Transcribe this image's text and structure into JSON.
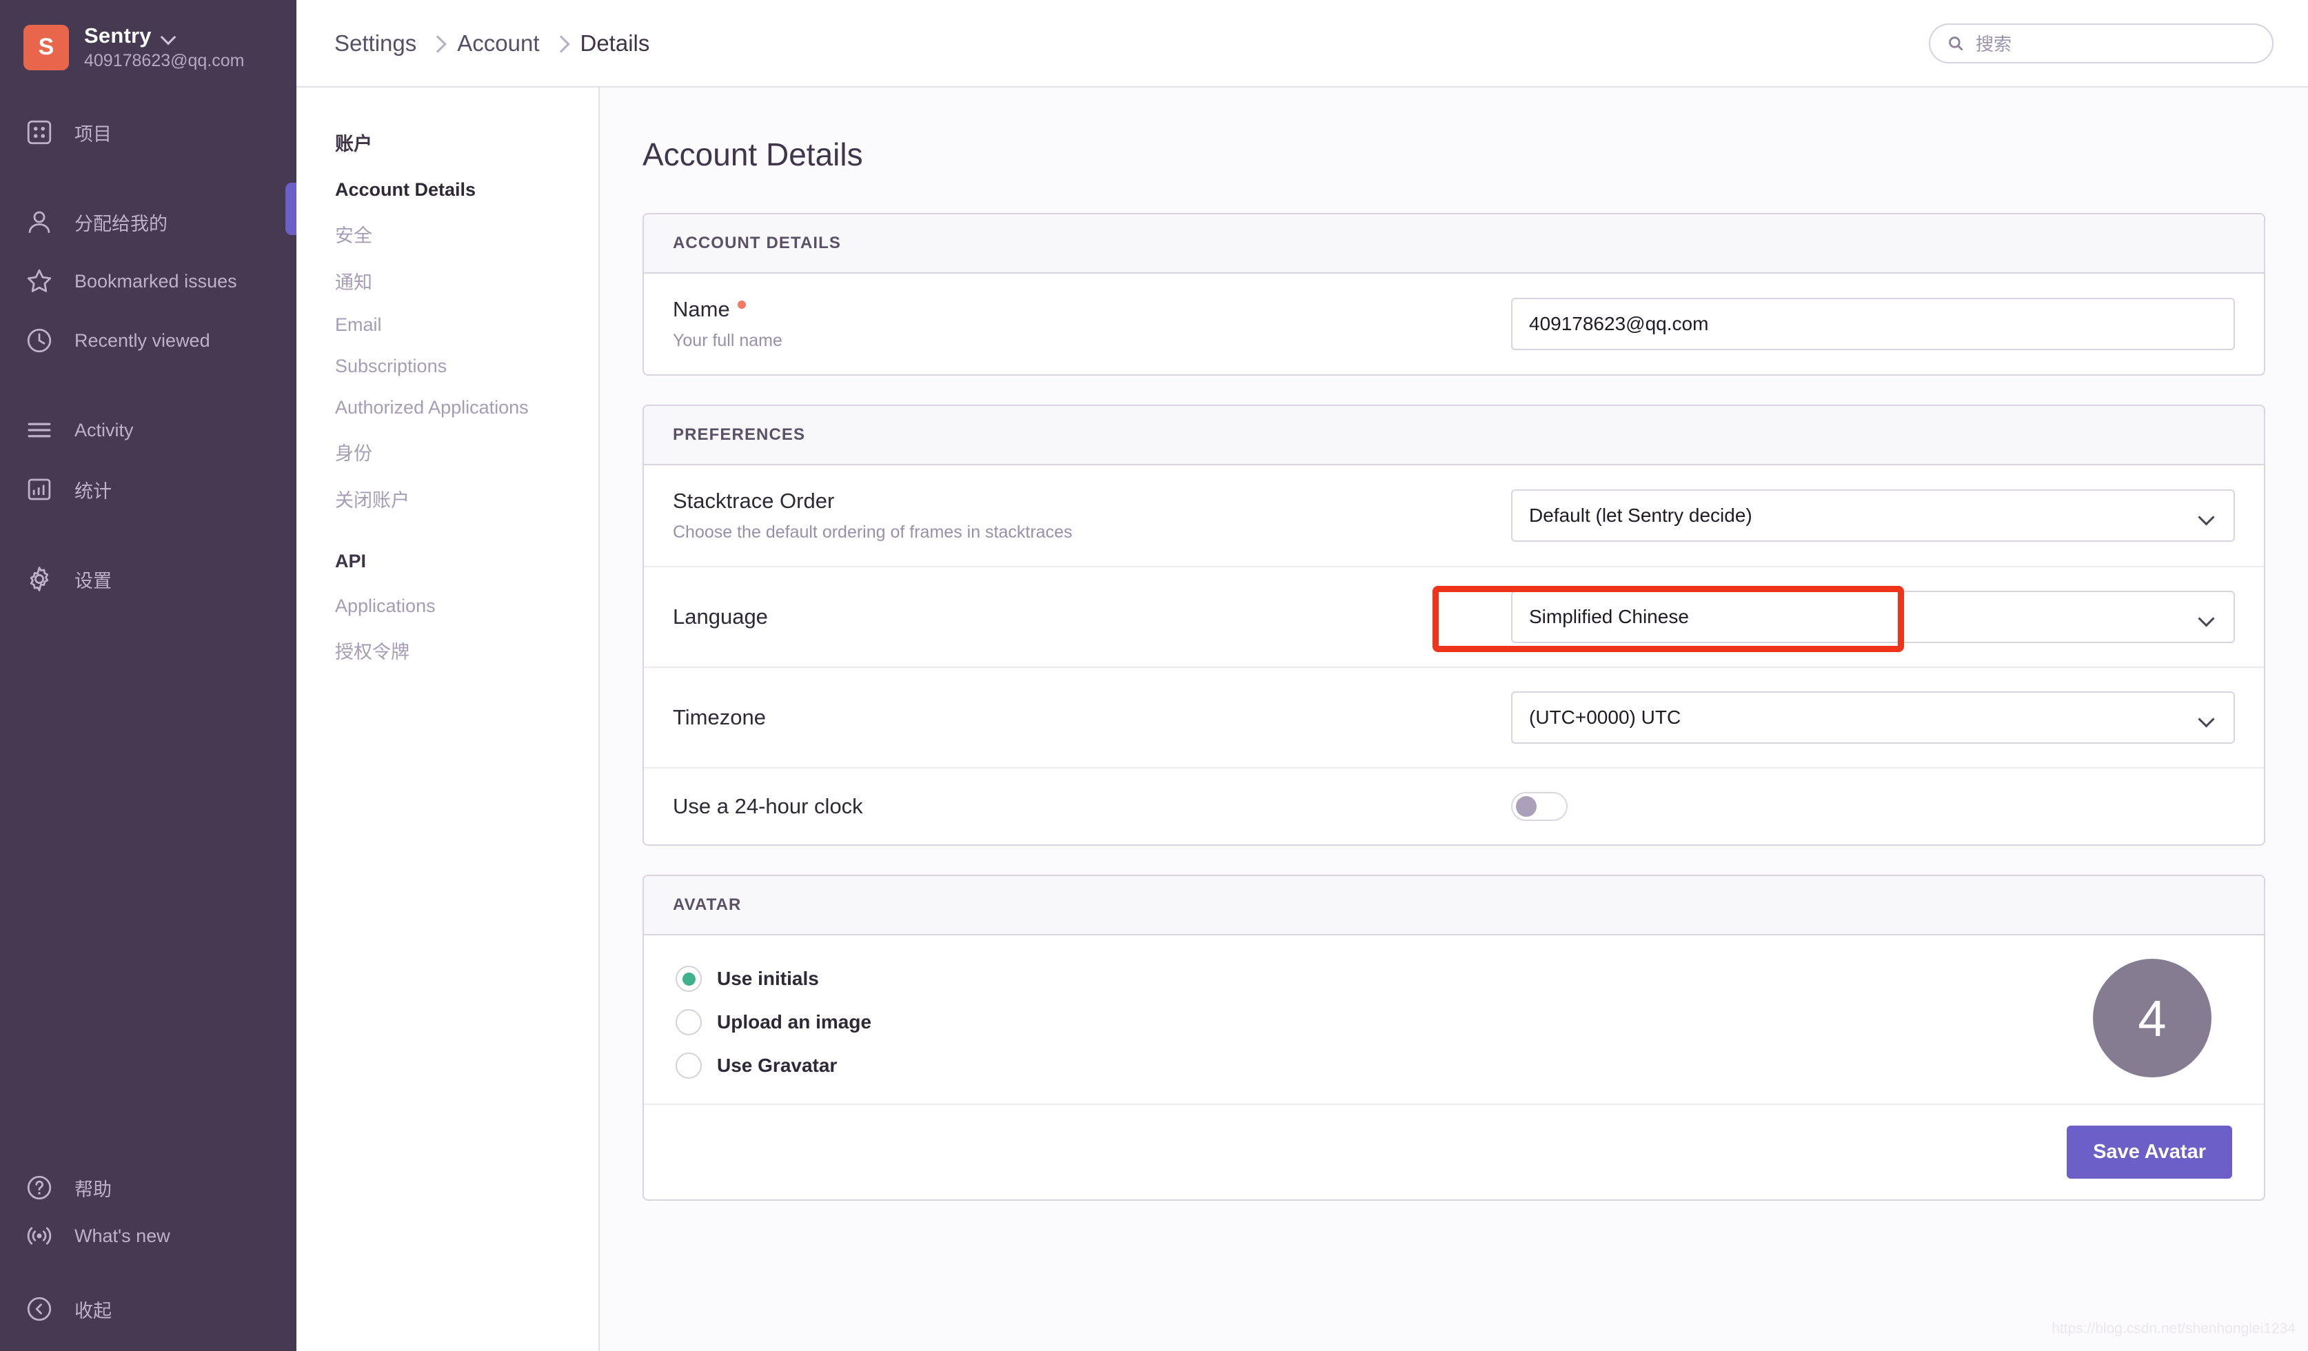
{
  "sidebar": {
    "org": {
      "initial": "S",
      "name": "Sentry",
      "email": "409178623@qq.com"
    },
    "nav_primary": [
      {
        "label": "项目",
        "icon": "projects-icon"
      }
    ],
    "nav_secondary": [
      {
        "label": "分配给我的",
        "icon": "user-icon"
      },
      {
        "label": "Bookmarked issues",
        "icon": "star-icon"
      },
      {
        "label": "Recently viewed",
        "icon": "clock-icon"
      }
    ],
    "nav_tertiary": [
      {
        "label": "Activity",
        "icon": "list-icon"
      },
      {
        "label": "统计",
        "icon": "stats-icon"
      }
    ],
    "nav_quaternary": [
      {
        "label": "设置",
        "icon": "gear-icon"
      }
    ],
    "nav_bottom": [
      {
        "label": "帮助",
        "icon": "help-circle-icon"
      },
      {
        "label": "What's new",
        "icon": "broadcast-icon"
      }
    ],
    "collapse": {
      "label": "收起",
      "icon": "chevron-left-circle-icon"
    }
  },
  "topbar": {
    "breadcrumb": [
      "Settings",
      "Account",
      "Details"
    ],
    "search": {
      "placeholder": "搜索",
      "value": "",
      "icon": "search-icon"
    }
  },
  "settings_nav": {
    "account_heading": "账户",
    "account_items": [
      {
        "label": "Account Details",
        "active": true
      },
      {
        "label": "安全",
        "active": false
      },
      {
        "label": "通知",
        "active": false
      },
      {
        "label": "Email",
        "active": false
      },
      {
        "label": "Subscriptions",
        "active": false
      },
      {
        "label": "Authorized Applications",
        "active": false
      },
      {
        "label": "身份",
        "active": false
      },
      {
        "label": "关闭账户",
        "active": false
      }
    ],
    "api_heading": "API",
    "api_items": [
      {
        "label": "Applications"
      },
      {
        "label": "授权令牌"
      }
    ]
  },
  "content": {
    "page_title": "Account Details",
    "account_details_panel": {
      "header": "ACCOUNT DETAILS",
      "name_label": "Name",
      "name_help": "Your full name",
      "name_value": "409178623@qq.com",
      "required_marker": "required-dot"
    },
    "preferences_panel": {
      "header": "PREFERENCES",
      "stacktrace_label": "Stacktrace Order",
      "stacktrace_help": "Choose the default ordering of frames in stacktraces",
      "stacktrace_value": "Default (let Sentry decide)",
      "language_label": "Language",
      "language_value": "Simplified Chinese",
      "timezone_label": "Timezone",
      "timezone_value": "(UTC+0000) UTC",
      "clock_label": "Use a 24-hour clock",
      "clock_state": "off"
    },
    "avatar_panel": {
      "header": "AVATAR",
      "options": [
        {
          "label": "Use initials",
          "selected": true
        },
        {
          "label": "Upload an image",
          "selected": false
        },
        {
          "label": "Use Gravatar",
          "selected": false
        }
      ],
      "preview_initial": "4",
      "save_label": "Save Avatar"
    }
  },
  "annotation": {
    "type": "red-highlight-rectangle",
    "target": "language-select"
  },
  "watermark": "https://blog.csdn.net/shenhonglei1234",
  "colors": {
    "sidebar_bg": "#453A52",
    "org_avatar": "#E8664B",
    "accent_purple": "#6C5FC7",
    "radio_green": "#3FB28B",
    "required_salmon": "#F07A66",
    "annotation_red": "#F0341B",
    "avatar_gray": "#857C91"
  }
}
